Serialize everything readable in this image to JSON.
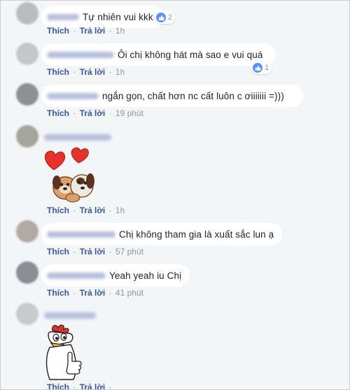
{
  "actions": {
    "like": "Thích",
    "reply": "Trả lời",
    "sep": "·"
  },
  "comments": [
    {
      "text": "Tự nhiên vui kkk",
      "time": "1h",
      "likes": "2"
    },
    {
      "text": "Ôi chị không hát mà sao e vui quá",
      "time": "1h",
      "likes": "1"
    },
    {
      "text": "ngắn gọn, chất hơn nc cất luôn c ơiiiiiii =)))",
      "time": "19 phút"
    },
    {
      "sticker": "dogs-hearts-sticker",
      "time": "1h"
    },
    {
      "text": "Chị không tham gia là xuất sắc lun ạ",
      "time": "57 phút"
    },
    {
      "text": "Yeah yeah iu Chị",
      "time": "41 phút"
    },
    {
      "sticker": "rooster-thumbs-up-sticker",
      "time": ""
    }
  ],
  "colors": {
    "link": "#365899",
    "meta": "#90949c",
    "like_blue": "#5890ff",
    "bubble": "#ffffff",
    "background": "#f4f5f7"
  }
}
